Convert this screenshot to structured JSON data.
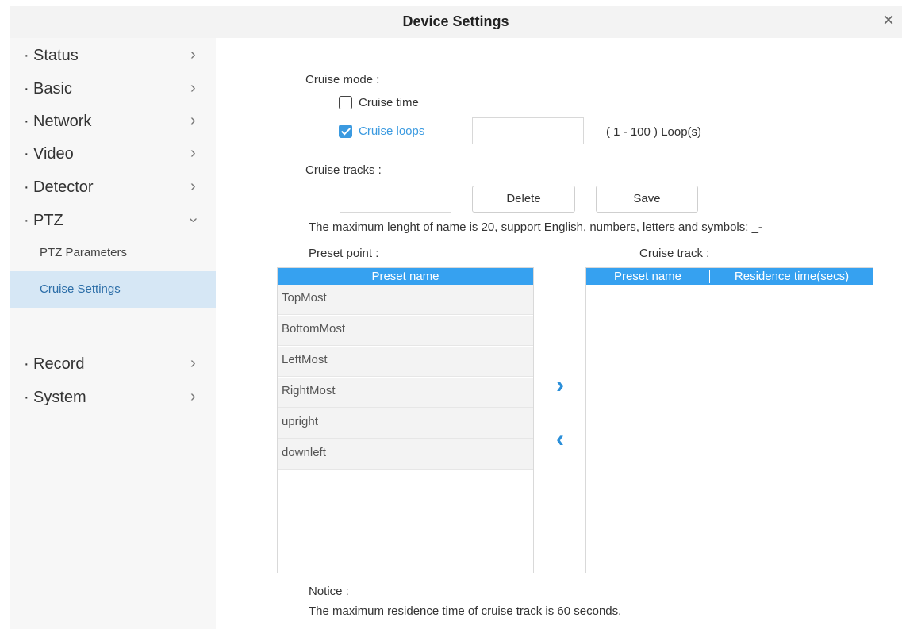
{
  "window": {
    "title": "Device Settings",
    "close_glyph": "×"
  },
  "sidebar": {
    "menu": [
      {
        "label": "Status",
        "chevron": "›"
      },
      {
        "label": "Basic",
        "chevron": "›"
      },
      {
        "label": "Network",
        "chevron": "›"
      },
      {
        "label": "Video",
        "chevron": "›"
      },
      {
        "label": "Detector",
        "chevron": "›"
      },
      {
        "label": "PTZ",
        "chevron": "›",
        "expanded": true
      },
      {
        "label": "Record",
        "chevron": "›"
      },
      {
        "label": "System",
        "chevron": "›"
      }
    ],
    "bullet": "·",
    "ptz_sub": [
      {
        "label": "PTZ Parameters"
      },
      {
        "label": "Cruise Settings",
        "active": true
      }
    ]
  },
  "cruise": {
    "mode_label": "Cruise mode :",
    "time_label": "Cruise time",
    "time_checked": false,
    "loops_label": "Cruise loops",
    "loops_checked": true,
    "loops_value": "",
    "loops_range": "( 1 - 100 ) Loop(s)",
    "tracks_label": "Cruise tracks :",
    "track_name_value": "",
    "delete_label": "Delete",
    "save_label": "Save",
    "hint": "The maximum lenght of name is 20, support English, numbers, letters and symbols: _-"
  },
  "preset_panel": {
    "label": "Preset point :",
    "header": "Preset name",
    "rows": [
      "TopMost",
      "BottomMost",
      "LeftMost",
      "RightMost",
      "upright",
      "downleft"
    ]
  },
  "track_panel": {
    "label": "Cruise track :",
    "headers": [
      "Preset name",
      "Residence time(secs)"
    ],
    "rows": []
  },
  "arrows": {
    "add": "›",
    "remove": "‹"
  },
  "notice": {
    "title": "Notice :",
    "text": "The maximum residence time of cruise track is 60 seconds."
  },
  "colors": {
    "accent": "#36a1f0",
    "active_bg": "#d6e7f5",
    "link": "#2c6ea8"
  }
}
